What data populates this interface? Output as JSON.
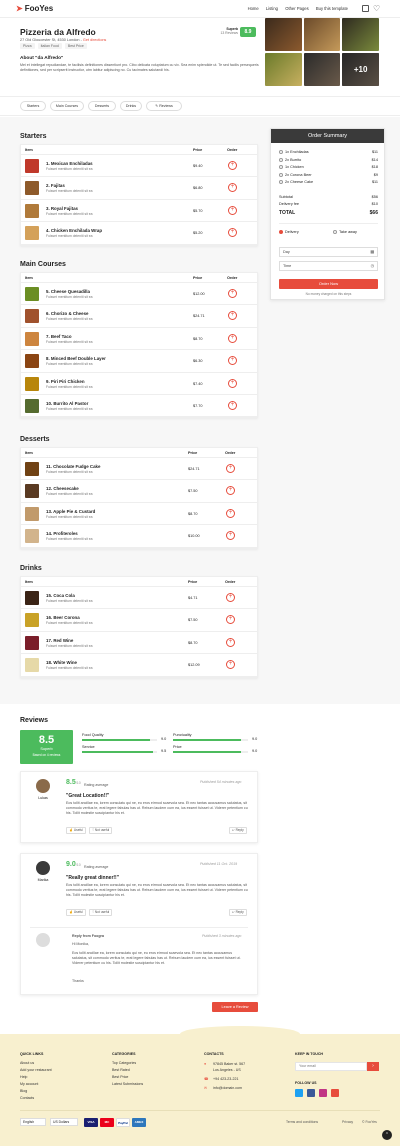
{
  "header": {
    "logo": "FooYes",
    "nav": [
      "Home",
      "Listing",
      "Other Pages",
      "Buy this template"
    ]
  },
  "restaurant": {
    "name": "Pizzeria da Alfredo",
    "address": "27 Old Gloucester St, 4530 London - ",
    "directions": "Get directions",
    "tags": [
      "Pizza",
      "Italian Food",
      "Best Price"
    ],
    "score_label": "Superb",
    "score_sub": "13 Reviews",
    "score": "8.9",
    "about_title": "About \"da Alfredo\"",
    "about_text": "Mei et intellegat repudiandae, te facilisis definitiones dissentiunt pro. Cibo delicata voluptatum cu vix. Sea enim splendide ut. Te sed facilis persequeris definitiones, sed per scripserit instructior, utm labitur adipiscing no. Cu tacimates salutandi his.",
    "gallery_more": "+10"
  },
  "categories": [
    "Starters",
    "Main Courses",
    "Desserts",
    "Drinks",
    "Reviews"
  ],
  "table_headers": {
    "item": "Item",
    "price": "Price",
    "order": "Order"
  },
  "desc": "Fuisset mentitum deleniti sit ea",
  "sections": [
    {
      "title": "Starters",
      "items": [
        {
          "name": "1. Mexican Enchiladas",
          "price": "$9.40"
        },
        {
          "name": "2. Fajitas",
          "price": "$6.80"
        },
        {
          "name": "3. Royal Fajitas",
          "price": "$5.70"
        },
        {
          "name": "4. Chicken Enchilada Wrap",
          "price": "$5.20"
        }
      ]
    },
    {
      "title": "Main Courses",
      "items": [
        {
          "name": "5. Cheese Quesadilla",
          "price": "$12.00"
        },
        {
          "name": "6. Chorizo & Cheese",
          "price": "$24.71"
        },
        {
          "name": "7. Beef Taco",
          "price": "$8.70"
        },
        {
          "name": "8. Minced Beef Double Layer",
          "price": "$6.30"
        },
        {
          "name": "9. Piri Piri Chicken",
          "price": "$7.40"
        },
        {
          "name": "10. Burrito Al Pastor",
          "price": "$7.70"
        }
      ]
    },
    {
      "title": "Desserts",
      "items": [
        {
          "name": "11. Chocolate Fudge Cake",
          "price": "$24.71"
        },
        {
          "name": "12. Cheesecake",
          "price": "$7.50"
        },
        {
          "name": "13. Apple Pie & Custard",
          "price": "$8.70"
        },
        {
          "name": "14. Profiteroles",
          "price": "$10.00"
        }
      ]
    },
    {
      "title": "Drinks",
      "items": [
        {
          "name": "15. Coca Cola",
          "price": "$4.71"
        },
        {
          "name": "16. Beer Corona",
          "price": "$7.50"
        },
        {
          "name": "17. Red Wine",
          "price": "$8.70"
        },
        {
          "name": "18. White Wine",
          "price": "$12.09"
        }
      ]
    }
  ],
  "order_summary": {
    "title": "Order Summary",
    "lines": [
      {
        "item": "1x Enchiladas",
        "price": "$11"
      },
      {
        "item": "2x Burrito",
        "price": "$14"
      },
      {
        "item": "1x Chicken",
        "price": "$18"
      },
      {
        "item": "2x Corona Beer",
        "price": "$9"
      },
      {
        "item": "2x Cheese Cake",
        "price": "$11"
      }
    ],
    "subtotal_label": "Subtotal",
    "subtotal": "$56",
    "delivery_label": "Delivery fee",
    "delivery": "$10",
    "total_label": "TOTAL",
    "total": "$66",
    "option_delivery": "Delivery",
    "option_takeaway": "Take away",
    "day_placeholder": "Day",
    "time_placeholder": "Time",
    "order_button": "Order Now",
    "note": "No money charged on this steps"
  },
  "reviews": {
    "title": "Reviews",
    "overall_score": "8.5",
    "overall_label": "Superb",
    "overall_sub": "Based on 4 reviews",
    "bars": [
      {
        "label": "Food Quality",
        "value": "9.0",
        "pct": 0.9
      },
      {
        "label": "Service",
        "value": "9.5",
        "pct": 0.95
      },
      {
        "label": "Punctuality",
        "value": "9.0",
        "pct": 0.9
      },
      {
        "label": "Price",
        "value": "9.0",
        "pct": 0.9
      }
    ],
    "items": [
      {
        "name": "Lukas",
        "score": "8.5",
        "scale": "/10",
        "avg": "Rating average",
        "published": "Published 54 minutes ago",
        "title": "\"Great Location!!\"",
        "text": "Eos tollit ancillae ea, lorem consulatu qui ne, eu eros eirmod scaevola sea. Et nec tantas accusamus salutatus, sit commodo veritus te, erat legere fabulas has ut. Rebum laudem cum ea, ius essent fuisset ut. Viderer petentium cu his. Tollit molestie suscipiantur his et.",
        "useful": "Useful",
        "not_useful": "Not useful",
        "reply": "Reply"
      },
      {
        "name": "Marika",
        "score": "9.0",
        "scale": "/10",
        "avg": "Rating average",
        "published": "Published 11 Oct. 2019",
        "title": "\"Really great dinner!!\"",
        "text": "Eos tollit ancillae ea, lorem consulatu qui ne, eu eros eirmod scaevola sea. Et nec tantas accusamus salutatus, sit commodo veritus te, erat legere fabulas has ut. Rebum laudem cum ea, ius essent fuisset ut. Viderer petentium cu his. Tollit molestie suscipiantur his et.",
        "useful": "Useful",
        "not_useful": "Not useful",
        "reply": "Reply"
      }
    ],
    "owner_reply": {
      "from": "Reply from Foogra",
      "published": "Published 3 minutes ago",
      "greeting": "Hi Monika,",
      "text": "Eos tollit ancillae ea, lorem consulatu qui ne, eu eros eirmod scaevola sea. Et nec tantas accusamus salutatus, sit commodo veritus te, erat legere fabulas has ut. Rebum laudem cum ea, ius essent fuisset ut. Viderer petentium cu his. Tollit molestie suscipiantur his et.",
      "signoff": "Thanks"
    },
    "leave_button": "Leave a Review"
  },
  "footer": {
    "quick_links_title": "QUICK LINKS",
    "quick_links": [
      "About us",
      "Add your restaurant",
      "Help",
      "My account",
      "Blog",
      "Contacts"
    ],
    "categories_title": "CATEGORIES",
    "categories": [
      "Top Categories",
      "Best Rated",
      "Best Price",
      "Latest Submissions"
    ],
    "contacts_title": "CONTACTS",
    "address_line1": "97845 Baker st. 567",
    "address_line2": "Los Angeles - US",
    "phone": "+94 423-23-221",
    "email": "info@domain.com",
    "newsletter_title": "KEEP IN TOUCH",
    "email_placeholder": "Your email",
    "follow_title": "FOLLOW US",
    "language": "English",
    "currency": "US Dollars",
    "cards": [
      "VISA",
      "MC",
      "PayPal",
      "AMEX"
    ],
    "legal": [
      "Terms and conditions",
      "Privacy",
      "© FooYes"
    ]
  },
  "colors": {
    "accent": "#e74c3c",
    "score_green": "#4cbb5d",
    "footer_bg": "#f8f0cf"
  }
}
